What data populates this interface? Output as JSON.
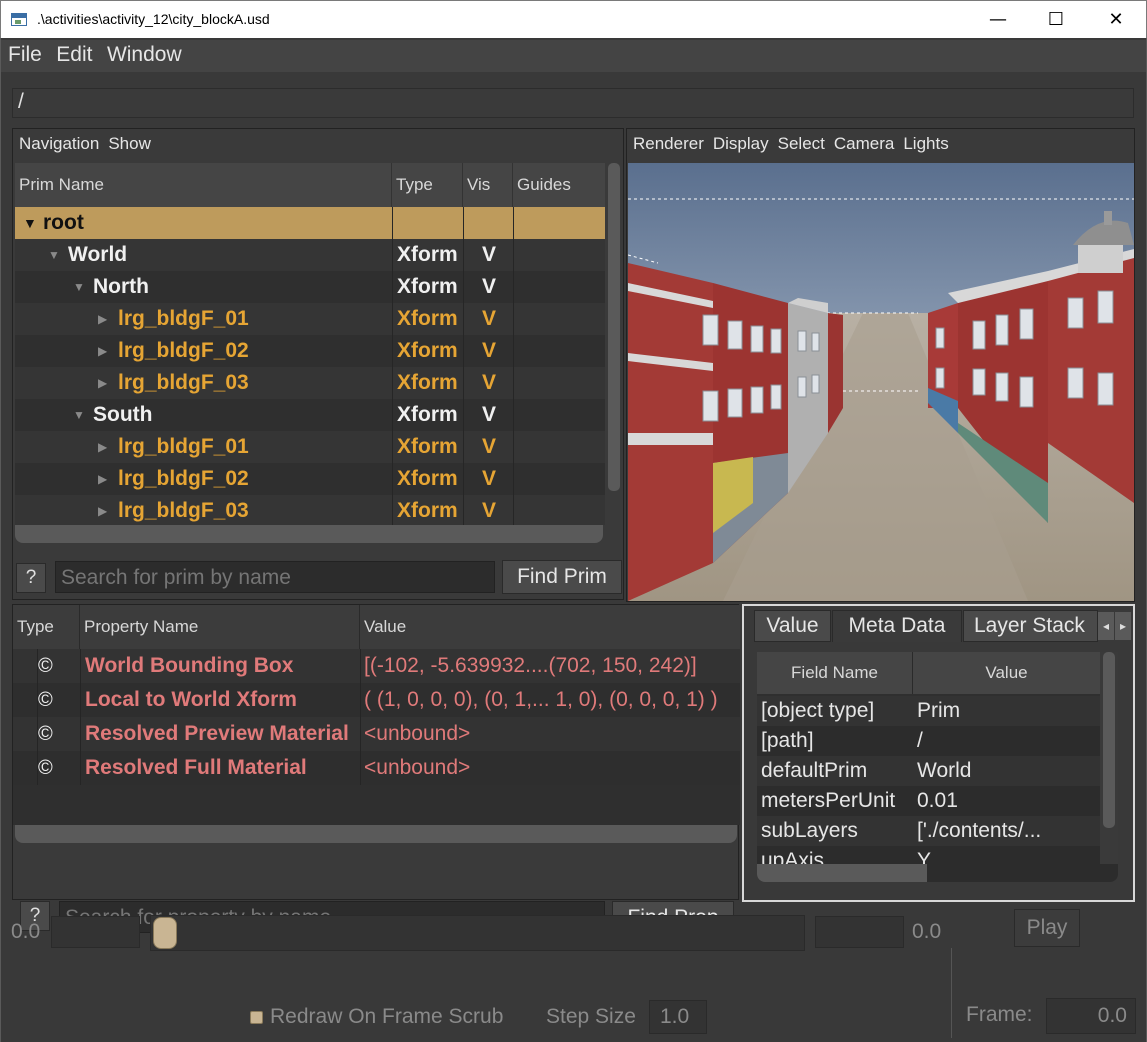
{
  "window": {
    "title": ".\\activities\\activity_12\\city_blockA.usd",
    "minimize": "—",
    "maximize": "☐",
    "close": "✕"
  },
  "menubar": {
    "items": [
      "File",
      "Edit",
      "Window"
    ]
  },
  "path": "/",
  "tree": {
    "menu": [
      "Navigation",
      "Show"
    ],
    "columns": [
      "Prim Name",
      "Type",
      "Vis",
      "Guides"
    ],
    "rows": [
      {
        "name": "root",
        "type": "",
        "vis": "",
        "depth": 0,
        "expanded": true,
        "selected": true,
        "color": "dark"
      },
      {
        "name": "World",
        "type": "Xform",
        "vis": "V",
        "depth": 1,
        "expanded": true,
        "color": "white"
      },
      {
        "name": "North",
        "type": "Xform",
        "vis": "V",
        "depth": 2,
        "expanded": true,
        "color": "white"
      },
      {
        "name": "lrg_bldgF_01",
        "type": "Xform",
        "vis": "V",
        "depth": 3,
        "expanded": false,
        "color": "orange"
      },
      {
        "name": "lrg_bldgF_02",
        "type": "Xform",
        "vis": "V",
        "depth": 3,
        "expanded": false,
        "color": "orange"
      },
      {
        "name": "lrg_bldgF_03",
        "type": "Xform",
        "vis": "V",
        "depth": 3,
        "expanded": false,
        "color": "orange"
      },
      {
        "name": "South",
        "type": "Xform",
        "vis": "V",
        "depth": 2,
        "expanded": true,
        "color": "white"
      },
      {
        "name": "lrg_bldgF_01",
        "type": "Xform",
        "vis": "V",
        "depth": 3,
        "expanded": false,
        "color": "orange"
      },
      {
        "name": "lrg_bldgF_02",
        "type": "Xform",
        "vis": "V",
        "depth": 3,
        "expanded": false,
        "color": "orange"
      },
      {
        "name": "lrg_bldgF_03",
        "type": "Xform",
        "vis": "V",
        "depth": 3,
        "expanded": false,
        "color": "orange"
      }
    ],
    "help_label": "?",
    "search_placeholder": "Search for prim by name",
    "find_label": "Find Prim"
  },
  "viewport": {
    "menu": [
      "Renderer",
      "Display",
      "Select",
      "Camera",
      "Lights"
    ]
  },
  "properties": {
    "columns": [
      "Type",
      "Property Name",
      "Value"
    ],
    "rows": [
      {
        "icon": "©",
        "name": "World Bounding Box",
        "value": "[(-102, -5.639932....(702, 150, 242)]"
      },
      {
        "icon": "©",
        "name": "Local to World Xform",
        "value": "( (1, 0, 0, 0), (0, 1,... 1, 0), (0, 0, 0, 1) )"
      },
      {
        "icon": "©",
        "name": "Resolved Preview Material",
        "value": "<unbound>"
      },
      {
        "icon": "©",
        "name": "Resolved Full Material",
        "value": "<unbound>"
      }
    ],
    "help_label": "?",
    "search_placeholder": "Search for property by name",
    "find_label": "Find Prop"
  },
  "metadata": {
    "tabs": [
      "Value",
      "Meta Data",
      "Layer Stack"
    ],
    "active_tab": "Meta Data",
    "columns": [
      "Field Name",
      "Value"
    ],
    "rows": [
      {
        "field": "[object type]",
        "value": "Prim"
      },
      {
        "field": "[path]",
        "value": "/"
      },
      {
        "field": "defaultPrim",
        "value": "World"
      },
      {
        "field": "metersPerUnit",
        "value": "0.01"
      },
      {
        "field": "subLayers",
        "value": "['./contents/..."
      },
      {
        "field": "upAxis",
        "value": "Y"
      }
    ],
    "scroll_left": "◂",
    "scroll_right": "▸"
  },
  "timeline": {
    "start_value": "0.0",
    "end_value": "0.0",
    "redraw_label": "Redraw On Frame Scrub",
    "redraw_checked": true,
    "step_size_label": "Step Size",
    "step_size": "1.0",
    "play_label": "Play",
    "frame_label": "Frame:",
    "frame_value": "0.0"
  },
  "colors": {
    "background": "#393939",
    "selection": "#be9b5c",
    "prim_orange": "#e6a534",
    "property_red": "#e07a7a"
  }
}
